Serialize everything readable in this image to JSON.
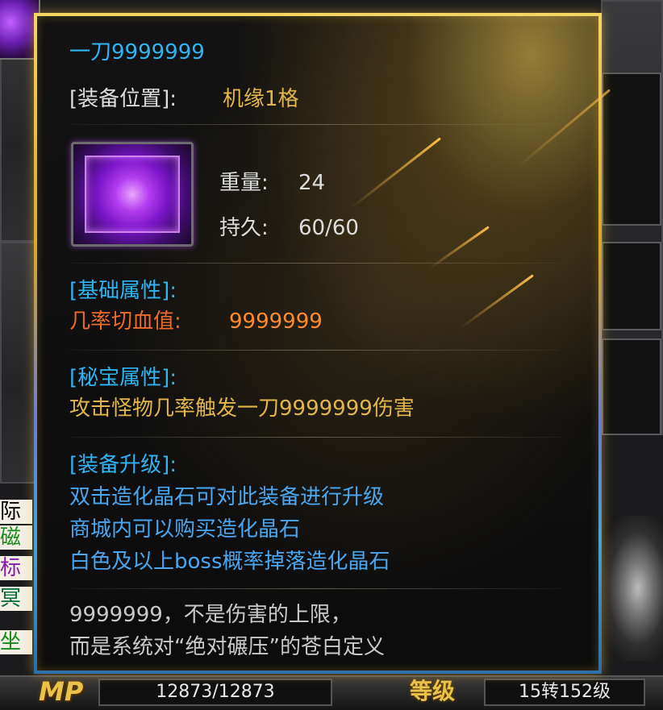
{
  "tooltip": {
    "item_name": "一刀9999999",
    "equip_slot_label": "[装备位置]:",
    "equip_slot_value": "机缘1格",
    "weight_label": "重量:",
    "weight_value": "24",
    "durability_label": "持久:",
    "durability_value": "60/60",
    "base_attr_header": "[基础属性]:",
    "base_attr_label": "几率切血值:",
    "base_attr_value": "9999999",
    "secret_attr_header": "[秘宝属性]:",
    "secret_attr_text": "攻击怪物几率触发一刀9999999伤害",
    "upgrade_header": "[装备升级]:",
    "upgrade_lines": [
      "双击造化晶石可对此装备进行升级",
      "商城内可以购买造化晶石",
      "白色及以上boss概率掉落造化晶石"
    ],
    "flavor_lines": [
      "9999999，不是伤害的上限，",
      "而是系统对“绝对碾压”的苍白定义"
    ]
  },
  "hud": {
    "mp_label": "MP",
    "mp_value": "12873/12873",
    "level_label": "等级",
    "level_value": "15转152级"
  },
  "side_chars": [
    "际",
    "磁",
    "标",
    "冥",
    "坐"
  ],
  "colors": {
    "title_cyan": "#2fb4f4",
    "gold": "#e3b64c",
    "orange": "#ff8a2a",
    "blue": "#49a6ef",
    "border_gold": "#c9a22a",
    "border_blue": "#4aa3d8"
  },
  "icons": [
    "item-icon-purple-claw",
    "decorative-serpent-icon"
  ]
}
